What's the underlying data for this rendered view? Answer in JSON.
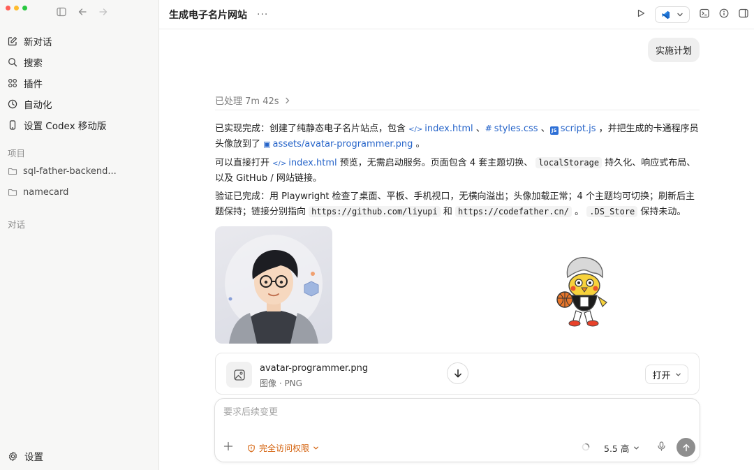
{
  "sidebar": {
    "items": [
      {
        "label": "新对话",
        "icon": "edit-icon"
      },
      {
        "label": "搜索",
        "icon": "search-icon"
      },
      {
        "label": "插件",
        "icon": "plugins-icon"
      },
      {
        "label": "自动化",
        "icon": "clock-icon"
      },
      {
        "label": "设置 Codex 移动版",
        "icon": "phone-icon"
      }
    ],
    "projects_label": "项目",
    "projects": [
      "sql-father-backend...",
      "namecard"
    ],
    "conversations_label": "对话",
    "settings_label": "设置"
  },
  "header": {
    "title": "生成电子名片网站",
    "more": "···"
  },
  "chat": {
    "user_message": "实施计划",
    "processed": "已处理 7m 42s",
    "p1": {
      "a": "已实现完成：创建了纯静态电子名片站点，包含 ",
      "link1": "index.html",
      "sep1": " 、",
      "link2": "styles.css",
      "sep2": " 、",
      "link3": "script.js",
      "b": " ，并把生成的卡通程序员头像放到了 ",
      "link4": "assets/avatar-programmer.png",
      "c": " 。"
    },
    "p2": {
      "a": "可以直接打开 ",
      "link1": "index.html",
      "b": " 预览，无需启动服务。页面包含 4 套主题切换、 ",
      "code1": "localStorage",
      "c": " 持久化、响应式布局、以及 GitHub / 网站链接。"
    },
    "p3": {
      "a": "验证已完成：用 Playwright 检查了桌面、平板、手机视口，无横向溢出；头像加载正常；4 个主题均可切换；刷新后主题保持；链接分别指向 ",
      "code1": "https://github.com/liyupi",
      "b": " 和 ",
      "code2": "https://codefather.cn/",
      "c": " 。 ",
      "code3": ".DS_Store",
      "d": " 保持未动。"
    },
    "file": {
      "name": "avatar-programmer.png",
      "meta": "图像 · PNG",
      "open_label": "打开"
    }
  },
  "composer": {
    "placeholder": "要求后续变更",
    "permission": "完全访问权限",
    "model": "5.5 高",
    "colors": {
      "permission": "#d4600a",
      "link": "#2664c9"
    }
  }
}
